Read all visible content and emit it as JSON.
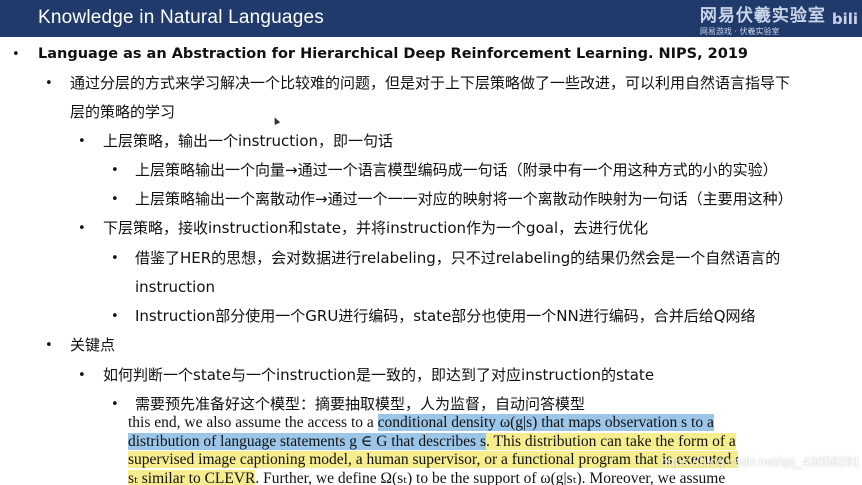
{
  "header": {
    "title": "Knowledge in Natural Languages",
    "logo_text": "网易伏羲实验室",
    "logo_sub": "网易游戏 · 伏羲实验室",
    "bili_text": "bili"
  },
  "bullets": [
    {
      "marker": "•",
      "text": "Language as an Abstraction for Hierarchical Deep Reinforcement Learning. NIPS, 2019"
    },
    {
      "marker": "•",
      "text": "通过分层的方式来学习解决一个比较难的问题，但是对于上下层策略做了一些改进，可以利用自然语言指导下"
    },
    {
      "marker": "",
      "text": "层的策略的学习"
    },
    {
      "marker": "•",
      "text": "上层策略，输出一个instruction，即一句话"
    },
    {
      "marker": "•",
      "text": "上层策略输出一个向量→通过一个语言模型编码成一句话（附录中有一个用这种方式的小的实验）"
    },
    {
      "marker": "•",
      "text": "上层策略输出一个离散动作→通过一个一一对应的映射将一个离散动作映射为一句话（主要用这种）"
    },
    {
      "marker": "•",
      "text": "下层策略，接收instruction和state，并将instruction作为一个goal，去进行优化"
    },
    {
      "marker": "•",
      "text": "借鉴了HER的思想，会对数据进行relabeling，只不过relabeling的结果仍然会是一个自然语言的"
    },
    {
      "marker": "",
      "text": "instruction"
    },
    {
      "marker": "•",
      "text": "Instruction部分使用一个GRU进行编码，state部分也使用一个NN进行编码，合并后给Q网络"
    },
    {
      "marker": "•",
      "text": "关键点"
    },
    {
      "marker": "•",
      "text": "如何判断一个state与一个instruction是一致的，即达到了对应instruction的state"
    },
    {
      "marker": "•",
      "text": "需要预先准备好这个模型：摘要抽取模型，人为监督，自动问答模型"
    }
  ],
  "paper_excerpt": {
    "line1_a": "this end, we also assume the access to a ",
    "line1_b": "conditional density ω(g|s) that maps observation s to a",
    "line2_a": "distribution of language statements g ∈ G that describes s",
    "line2_b": ". This distribution can take the form of a",
    "line3": "supervised image captioning model, a human supervisor, or a functional program that is executed on",
    "line4_a": "sₜ similar to CLEVR",
    "line4_b": ". Further, we define Ω(sₜ) to be the support of ω(g|sₜ). Moreover, we assume"
  },
  "watermark": "https://blog.csdn.net/qq_43058281",
  "colors": {
    "header_bg": "#1f3a6b",
    "highlight_blue": "#9cc6e8",
    "highlight_yellow": "#f6ee8e"
  }
}
